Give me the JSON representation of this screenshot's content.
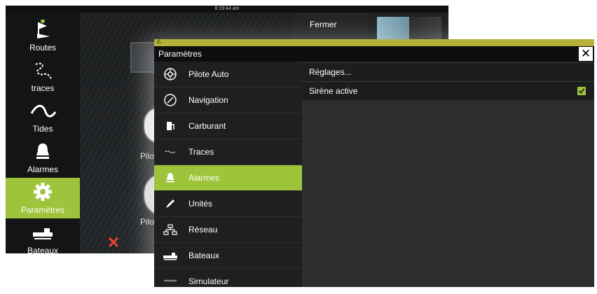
{
  "app": {
    "time": "8:19:44 am",
    "fermer_label": "Fermer",
    "bg_labels": [
      "Pilo",
      "Pilo"
    ]
  },
  "sidebar": {
    "items": [
      {
        "label": "Routes",
        "icon": "routes-icon"
      },
      {
        "label": "traces",
        "icon": "traces-icon"
      },
      {
        "label": "Tides",
        "icon": "tides-icon"
      },
      {
        "label": "Alarmes",
        "icon": "bell-icon"
      },
      {
        "label": "Paramètres",
        "icon": "gear-icon",
        "active": true
      },
      {
        "label": "Bateaux",
        "icon": "ship-icon"
      }
    ]
  },
  "dialog": {
    "title": "Paramètres",
    "menu": [
      {
        "label": "Pilote Auto",
        "icon": "autopilot-icon"
      },
      {
        "label": "Navigation",
        "icon": "compass-icon"
      },
      {
        "label": "Carburant",
        "icon": "fuel-icon"
      },
      {
        "label": "Traces",
        "icon": "trail-icon"
      },
      {
        "label": "Alarmes",
        "icon": "bell-icon",
        "active": true
      },
      {
        "label": "Unités",
        "icon": "pencil-icon"
      },
      {
        "label": "Réseau",
        "icon": "network-icon"
      },
      {
        "label": "Bateaux",
        "icon": "ship-icon"
      },
      {
        "label": "Simulateur",
        "icon": "wave-icon"
      }
    ],
    "detail": [
      {
        "label": "Réglages..."
      },
      {
        "label": "Sirène active",
        "checked": true
      }
    ]
  },
  "colors": {
    "accent": "#9dc43a",
    "title_bar": "#0d0e0f",
    "menu_bg": "#1d1f20"
  }
}
